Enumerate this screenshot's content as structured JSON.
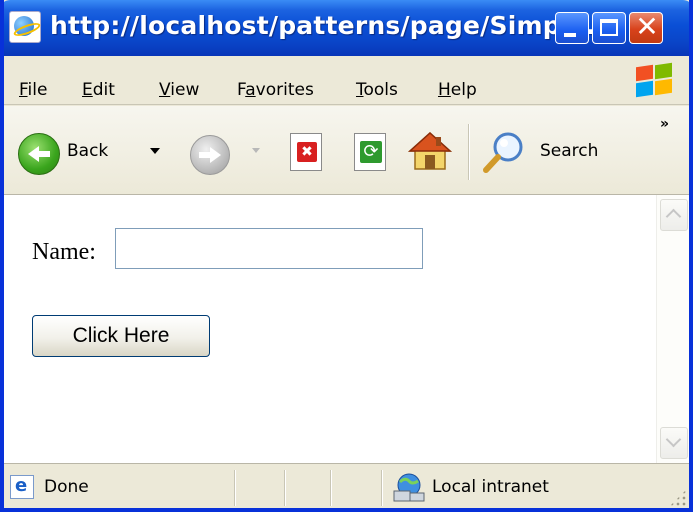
{
  "window": {
    "title": "http://localhost/patterns/page/Simpl…"
  },
  "menu": {
    "items": [
      {
        "accel": "F",
        "rest": "ile"
      },
      {
        "accel": "E",
        "rest": "dit"
      },
      {
        "accel": "V",
        "rest": "iew"
      },
      {
        "pre": "F",
        "accel": "a",
        "rest": "vorites"
      },
      {
        "accel": "T",
        "rest": "ools"
      },
      {
        "accel": "H",
        "rest": "elp"
      }
    ]
  },
  "toolbar": {
    "back_label": "Back",
    "search_label": "Search",
    "overflow": "»"
  },
  "page": {
    "name_label": "Name:",
    "name_value": "",
    "button_label": "Click Here"
  },
  "status": {
    "left_text": "Done",
    "zone_text": "Local intranet"
  },
  "colors": {
    "titlebar": "#0a4fd6",
    "close_button": "#d8421b",
    "chrome": "#ece9d8",
    "input_border": "#7f9db9",
    "button_border": "#003c74"
  },
  "icons": [
    "ie-page-icon",
    "minimize-icon",
    "maximize-icon",
    "close-icon",
    "windows-logo-icon",
    "back-arrow-icon",
    "forward-arrow-icon",
    "stop-icon",
    "refresh-icon",
    "home-icon",
    "search-magnifier-icon",
    "ie-status-icon",
    "local-intranet-icon"
  ]
}
